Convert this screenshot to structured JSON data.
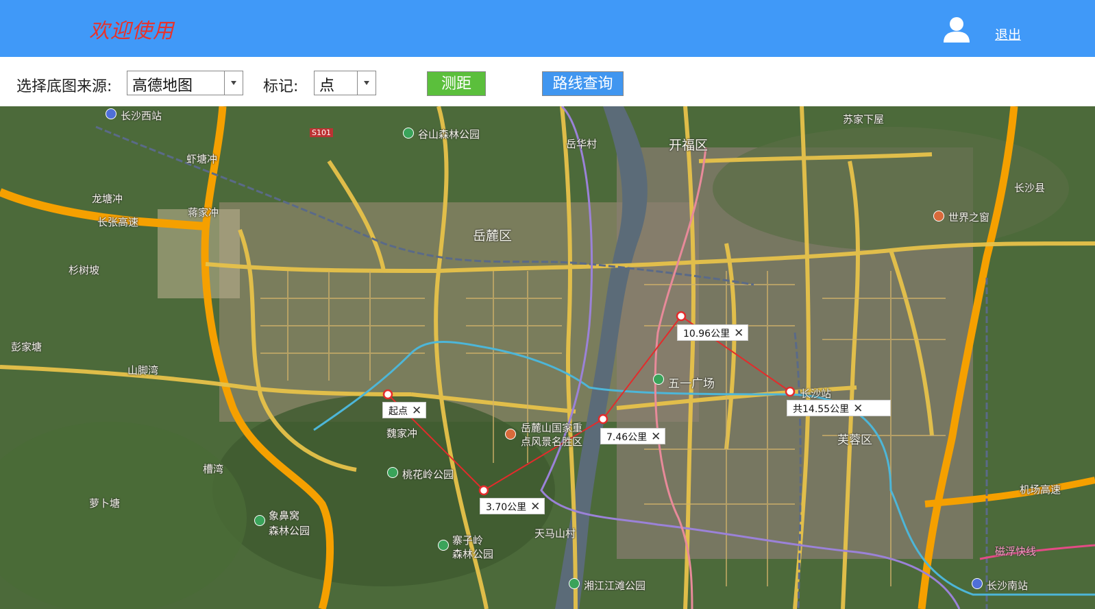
{
  "header": {
    "welcome": "欢迎使用",
    "logout": "退出"
  },
  "toolbar": {
    "basemap_label": "选择底图来源:",
    "basemap_value": "高德地图",
    "marker_label": "标记:",
    "marker_value": "点",
    "measure_button": "测距",
    "route_button": "路线查询"
  },
  "map": {
    "places": [
      {
        "name": "place-changsha-west-station",
        "text": "长沙西站"
      },
      {
        "name": "place-gushan-forest-park",
        "text": "谷山森林公园"
      },
      {
        "name": "place-s101",
        "text": "S101"
      },
      {
        "name": "place-yuehua-village",
        "text": "岳华村"
      },
      {
        "name": "place-kaifu-district",
        "text": "开福区"
      },
      {
        "name": "place-sujiaxiawu",
        "text": "苏家下屋"
      },
      {
        "name": "place-xiatangchong",
        "text": "虾塘冲"
      },
      {
        "name": "place-longtangchong",
        "text": "龙塘冲"
      },
      {
        "name": "place-jiangjiachong",
        "text": "蒋家冲"
      },
      {
        "name": "place-changzhang-expressway",
        "text": "长张高速"
      },
      {
        "name": "place-yuelu-district",
        "text": "岳麓区"
      },
      {
        "name": "place-changsha-county",
        "text": "长沙县"
      },
      {
        "name": "place-window-of-world",
        "text": "世界之窗"
      },
      {
        "name": "place-shanshupo",
        "text": "杉树坡"
      },
      {
        "name": "place-pengjiatang",
        "text": "彭家塘"
      },
      {
        "name": "place-shanjiaowan",
        "text": "山脚湾"
      },
      {
        "name": "place-wuyi-square",
        "text": "五一广场"
      },
      {
        "name": "place-changsha-station",
        "text": "长沙站"
      },
      {
        "name": "place-weijiachong",
        "text": "魏家冲"
      },
      {
        "name": "place-yuelu-mountain",
        "text": "岳麓山国家重"
      },
      {
        "name": "place-yuelu-mountain-2",
        "text": "点风景名胜区"
      },
      {
        "name": "place-furong-district",
        "text": "芙蓉区"
      },
      {
        "name": "place-taohualing-park",
        "text": "桃花岭公园"
      },
      {
        "name": "place-huwan",
        "text": "槽湾"
      },
      {
        "name": "place-luobutang",
        "text": "萝卜塘"
      },
      {
        "name": "place-xiangbiwo-park",
        "text": "象鼻窝"
      },
      {
        "name": "place-xiangbiwo-park-2",
        "text": "森林公园"
      },
      {
        "name": "place-tianma-village",
        "text": "天马山村"
      },
      {
        "name": "place-zhaizi-park",
        "text": "寨子岭"
      },
      {
        "name": "place-zhaizi-park-2",
        "text": "森林公园"
      },
      {
        "name": "place-airport-expressway",
        "text": "机场高速"
      },
      {
        "name": "place-maglev",
        "text": "磁浮快线"
      },
      {
        "name": "place-xiangjiang-park",
        "text": "湘江江滩公园"
      },
      {
        "name": "place-changsha-south-station",
        "text": "长沙南站"
      }
    ],
    "measure": {
      "start": "起点",
      "d1": "3.70公里",
      "d2": "7.46公里",
      "d3": "10.96公里",
      "total": "共14.55公里",
      "close": "✕"
    }
  }
}
